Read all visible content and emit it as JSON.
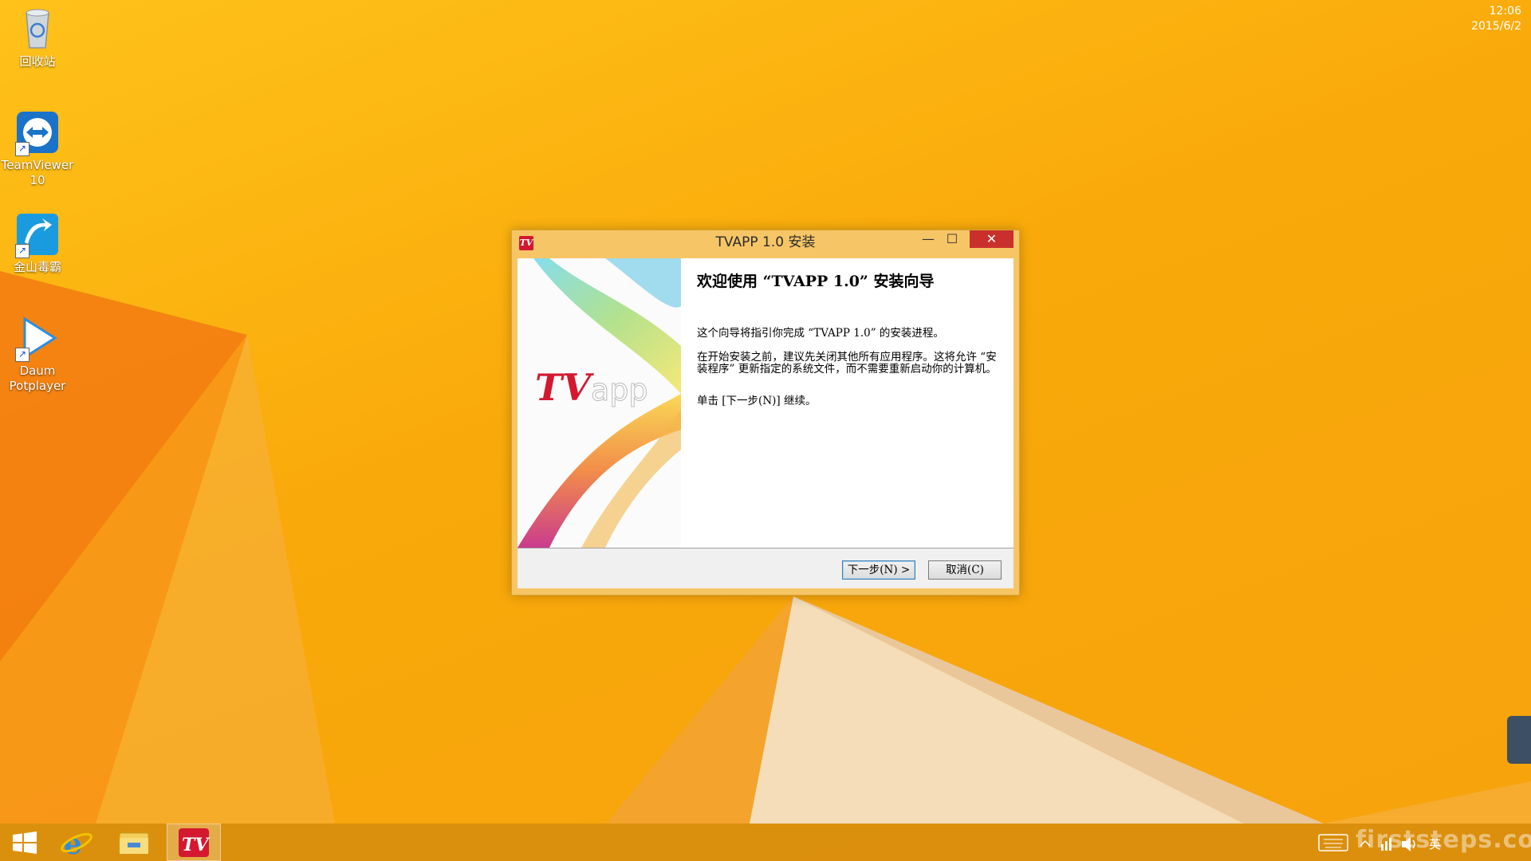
{
  "desktop": {
    "icons": [
      {
        "label": "回收站",
        "icon": "recycle-bin-icon"
      },
      {
        "label": "TeamViewer 10",
        "icon": "teamviewer-icon"
      },
      {
        "label": "金山毒霸",
        "icon": "kingsoft-antivirus-icon"
      },
      {
        "label": "Daum Potplayer",
        "icon": "potplayer-icon"
      }
    ]
  },
  "dialog": {
    "title": "TVAPP 1.0 安装",
    "app_icon_text": "TV",
    "minimize": "—",
    "maximize": "☐",
    "close": "✕",
    "banner_logo": "TVapp",
    "welcome_title": "欢迎使用 “TVAPP 1.0” 安装向导",
    "paragraphs": [
      "这个向导将指引你完成 “TVAPP 1.0” 的安装进程。",
      "在开始安装之前，建议先关闭其他所有应用程序。这将允许 “安装程序” 更新指定的系统文件，而不需要重新启动你的计算机。",
      "单击 [下一步(N)] 继续。"
    ],
    "buttons": {
      "next": "下一步(N) >",
      "cancel": "取消(C)"
    }
  },
  "taskbar": {
    "apps": [
      {
        "name": "start",
        "icon": "windows-logo-icon"
      },
      {
        "name": "internet-explorer",
        "icon": "ie-icon"
      },
      {
        "name": "file-explorer",
        "icon": "folder-icon"
      },
      {
        "name": "tvapp",
        "icon": "tvapp-icon"
      }
    ],
    "tray": {
      "input_method": "英",
      "time": "12:06",
      "date": "2015/6/2"
    }
  },
  "watermark": "firststeps.com.au",
  "colors": {
    "desktop": "#f9a90a",
    "dialog_frame": "#f6c566",
    "close_button": "#c9302c",
    "app_icon": "#d4182f"
  }
}
